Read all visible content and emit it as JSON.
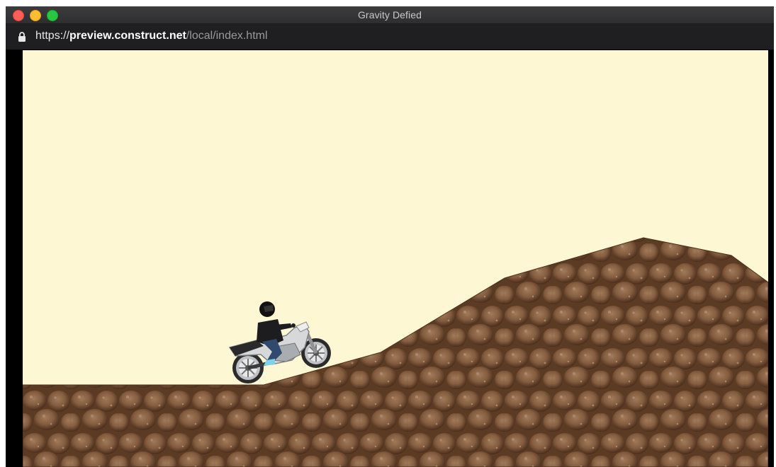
{
  "window": {
    "title": "Gravity Defied"
  },
  "address_bar": {
    "scheme": "https://",
    "host": "preview.construct.net",
    "path": "/local/index.html"
  },
  "game": {
    "sky_color": "#fdf7d3",
    "ground_color": "#7a5236",
    "player": "motorcycle-rider"
  },
  "icons": {
    "lock": "lock-icon",
    "close": "close-traffic-light",
    "minimize": "minimize-traffic-light",
    "maximize": "maximize-traffic-light"
  }
}
